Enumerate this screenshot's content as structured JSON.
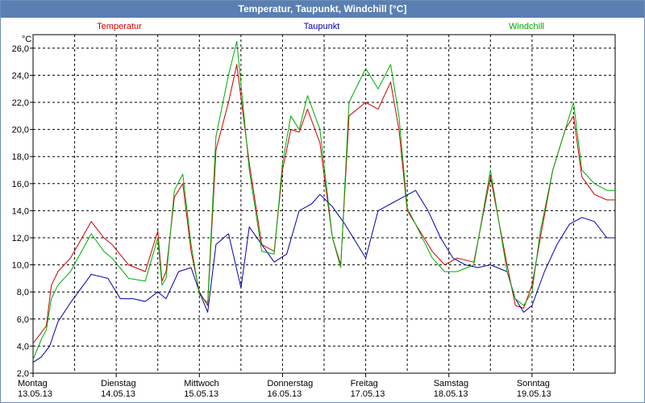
{
  "window": {
    "title": "Temperatur, Taupunkt, Windchill [°C]"
  },
  "chart_data": {
    "type": "line",
    "y_unit": "°C",
    "ylim": [
      2.0,
      27.0
    ],
    "y_ticks": [
      "2,0",
      "4,0",
      "6,0",
      "8,0",
      "10,0",
      "12,0",
      "14,0",
      "16,0",
      "18,0",
      "20,0",
      "22,0",
      "24,0",
      "26,0"
    ],
    "y_tick_values": [
      2,
      4,
      6,
      8,
      10,
      12,
      14,
      16,
      18,
      20,
      22,
      24,
      26
    ],
    "xlim": [
      0,
      7
    ],
    "x_ticks": [
      {
        "day": "Montag",
        "date": "13.05.13"
      },
      {
        "day": "Dienstag",
        "date": "14.05.13"
      },
      {
        "day": "Mittwoch",
        "date": "15.05.13"
      },
      {
        "day": "Donnerstag",
        "date": "16.05.13"
      },
      {
        "day": "Freitag",
        "date": "17.05.13"
      },
      {
        "day": "Samstag",
        "date": "18.05.13"
      },
      {
        "day": "Sonntag",
        "date": "19.05.13"
      }
    ],
    "grid": true,
    "series": [
      {
        "name": "Temperatur",
        "color": "#cc0000",
        "x": [
          0,
          0.1,
          0.16,
          0.22,
          0.3,
          0.45,
          0.7,
          0.85,
          0.95,
          1.15,
          1.35,
          1.5,
          1.55,
          1.6,
          1.7,
          1.8,
          1.9,
          2.0,
          2.1,
          2.2,
          2.35,
          2.45,
          2.6,
          2.75,
          2.9,
          3.0,
          3.1,
          3.2,
          3.3,
          3.45,
          3.6,
          3.7,
          3.8,
          4.0,
          4.15,
          4.3,
          4.4,
          4.5,
          4.6,
          4.8,
          4.95,
          5.1,
          5.3,
          5.5,
          5.7,
          5.8,
          5.9,
          6.0,
          6.1,
          6.25,
          6.4,
          6.5,
          6.6,
          6.75,
          6.9,
          7.0
        ],
        "y": [
          4.2,
          5.0,
          5.5,
          8.5,
          9.5,
          10.5,
          13.2,
          12.0,
          11.5,
          10.0,
          9.5,
          12.5,
          8.8,
          9.5,
          15.0,
          16.0,
          11.0,
          8.0,
          7.0,
          18.5,
          22.0,
          24.8,
          17.5,
          11.5,
          11.0,
          17.0,
          20.0,
          19.8,
          21.5,
          19.0,
          12.0,
          10.0,
          21.0,
          22.0,
          21.5,
          23.5,
          20.0,
          14.0,
          13.0,
          11.0,
          10.0,
          10.5,
          10.2,
          16.5,
          10.0,
          7.0,
          6.8,
          8.5,
          12.0,
          17.0,
          20.0,
          21.0,
          16.5,
          15.2,
          14.8,
          14.8
        ]
      },
      {
        "name": "Taupunkt",
        "color": "#0000aa",
        "x": [
          0,
          0.1,
          0.2,
          0.3,
          0.45,
          0.7,
          0.9,
          1.05,
          1.2,
          1.35,
          1.5,
          1.6,
          1.75,
          1.9,
          2.0,
          2.1,
          2.2,
          2.35,
          2.5,
          2.6,
          2.75,
          2.9,
          3.05,
          3.2,
          3.35,
          3.45,
          3.6,
          3.75,
          3.9,
          4.0,
          4.15,
          4.3,
          4.45,
          4.6,
          4.75,
          4.9,
          5.05,
          5.2,
          5.35,
          5.5,
          5.7,
          5.8,
          5.9,
          6.0,
          6.15,
          6.3,
          6.45,
          6.6,
          6.75,
          6.9,
          7.0
        ],
        "y": [
          2.8,
          3.2,
          4.0,
          5.8,
          7.2,
          9.3,
          9.0,
          7.5,
          7.5,
          7.3,
          8.0,
          7.5,
          9.5,
          9.8,
          8.0,
          6.5,
          11.5,
          12.3,
          8.3,
          12.8,
          11.5,
          10.2,
          10.8,
          14.0,
          14.5,
          15.2,
          14.3,
          13.0,
          11.5,
          10.5,
          14.0,
          14.5,
          15.0,
          15.5,
          14.0,
          12.0,
          10.5,
          10.0,
          9.8,
          10.0,
          9.5,
          7.5,
          6.5,
          7.0,
          9.5,
          11.5,
          13.0,
          13.5,
          13.2,
          12.0,
          12.0
        ]
      },
      {
        "name": "Windchill",
        "color": "#00aa00",
        "x": [
          0,
          0.1,
          0.16,
          0.22,
          0.3,
          0.45,
          0.7,
          0.85,
          0.95,
          1.15,
          1.35,
          1.5,
          1.55,
          1.6,
          1.7,
          1.8,
          1.9,
          2.0,
          2.1,
          2.2,
          2.35,
          2.45,
          2.6,
          2.75,
          2.9,
          3.0,
          3.1,
          3.2,
          3.3,
          3.45,
          3.6,
          3.7,
          3.8,
          4.0,
          4.15,
          4.3,
          4.4,
          4.5,
          4.6,
          4.8,
          4.95,
          5.1,
          5.3,
          5.5,
          5.7,
          5.8,
          5.9,
          6.0,
          6.1,
          6.25,
          6.4,
          6.5,
          6.6,
          6.75,
          6.9,
          7.0
        ],
        "y": [
          3.0,
          4.5,
          5.2,
          7.5,
          8.5,
          9.5,
          12.3,
          11.0,
          10.5,
          9.0,
          8.8,
          12.0,
          8.5,
          9.0,
          15.5,
          16.7,
          11.5,
          7.8,
          7.2,
          19.5,
          24.0,
          26.5,
          17.0,
          11.0,
          10.8,
          17.5,
          21.0,
          20.0,
          22.5,
          20.0,
          12.0,
          9.8,
          22.0,
          24.5,
          23.0,
          24.8,
          21.0,
          14.2,
          13.0,
          10.5,
          9.5,
          9.5,
          10.0,
          17.0,
          9.5,
          7.5,
          7.0,
          8.0,
          12.5,
          17.0,
          20.0,
          22.0,
          17.0,
          16.0,
          15.5,
          15.5
        ]
      }
    ]
  }
}
